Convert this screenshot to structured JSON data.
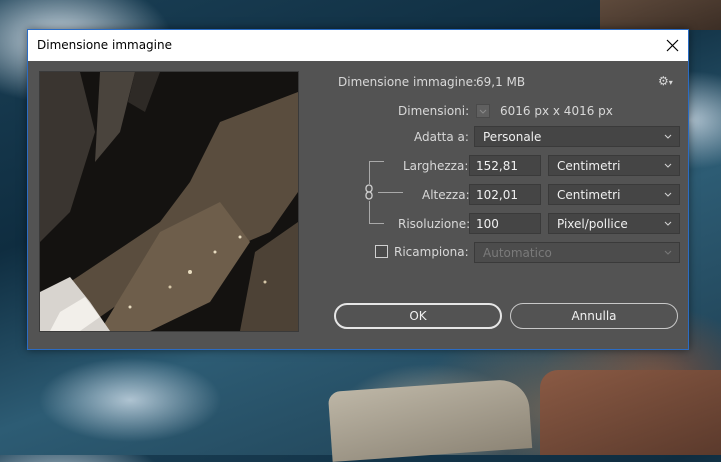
{
  "window": {
    "title": "Dimensione immagine"
  },
  "info": {
    "image_size_label": "Dimensione immagine:",
    "image_size_value": "69,1 MB",
    "dimensions_label": "Dimensioni:",
    "dimensions_value": "6016 px x 4016 px"
  },
  "fit": {
    "label": "Adatta a:",
    "value": "Personale"
  },
  "width": {
    "label": "Larghezza:",
    "value": "152,81",
    "unit": "Centimetri"
  },
  "height": {
    "label": "Altezza:",
    "value": "102,01",
    "unit": "Centimetri"
  },
  "resolution": {
    "label": "Risoluzione:",
    "value": "100",
    "unit": "Pixel/pollice"
  },
  "resample": {
    "label": "Ricampiona:",
    "value": "Automatico",
    "checked": false
  },
  "buttons": {
    "ok": "OK",
    "cancel": "Annulla"
  },
  "icons": {
    "gear": "gear-icon",
    "chain": "chain-link-icon",
    "close": "close-icon"
  }
}
